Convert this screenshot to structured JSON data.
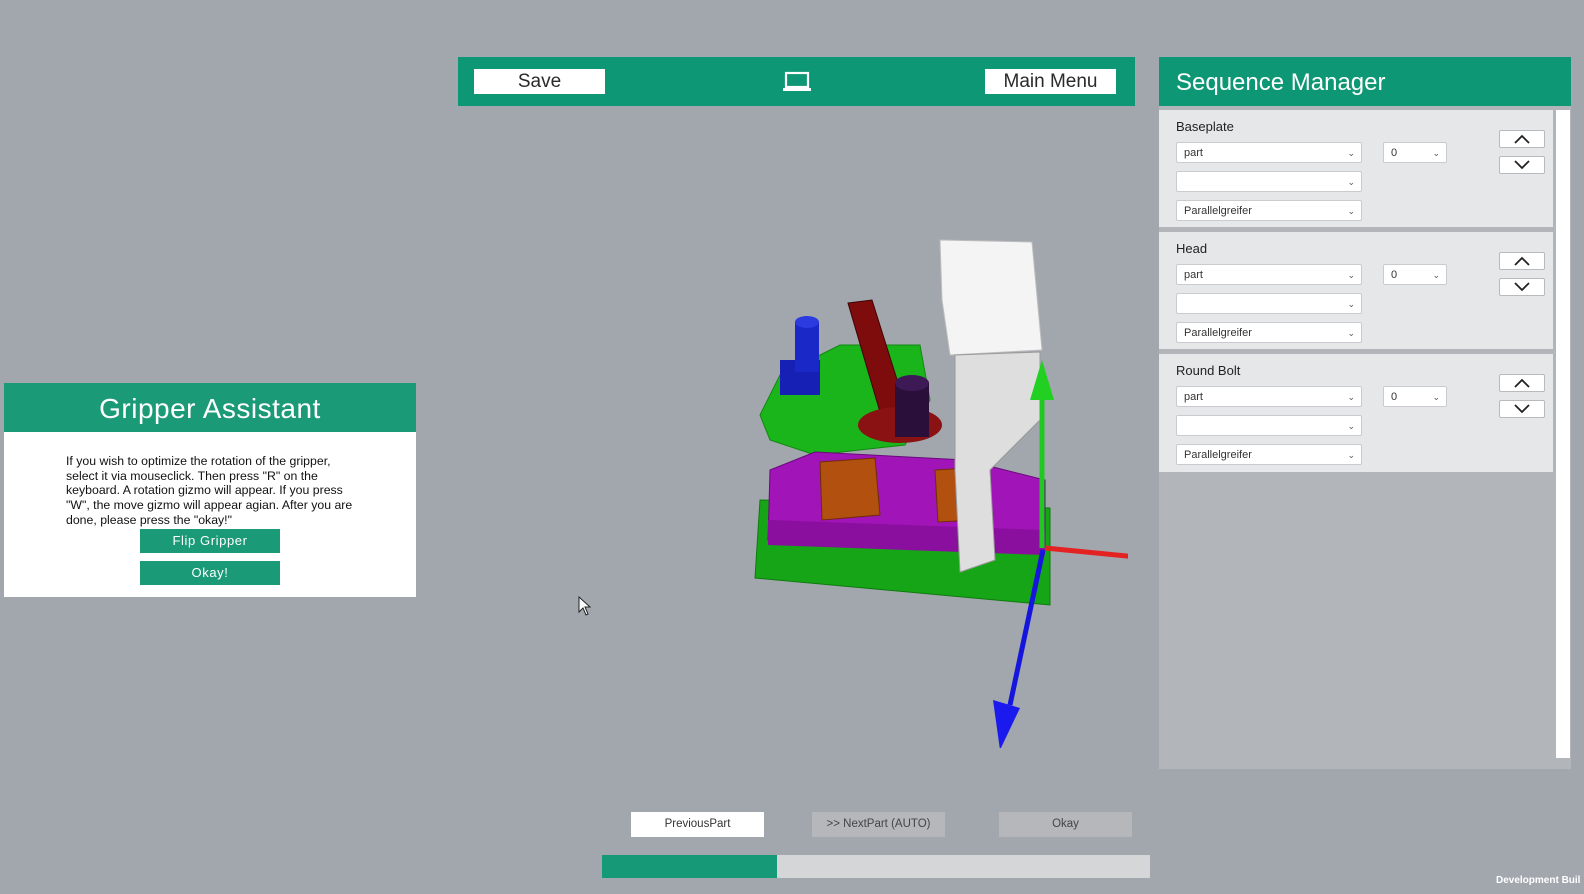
{
  "toolbar": {
    "save_label": "Save",
    "main_menu_label": "Main Menu",
    "center_icon": "laptop-icon"
  },
  "gripper_assistant": {
    "title": "Gripper Assistant",
    "instructions": "If you wish to optimize the rotation of the gripper, select it via mouseclick. Then press \"R\" on the keyboard. A rotation gizmo will appear. If you press \"W\", the move gizmo will appear agian. After you are done, please press the \"okay!\"",
    "flip_label": "Flip Gripper",
    "okay_label": "Okay!"
  },
  "sequence_manager": {
    "title": "Sequence Manager",
    "entries": [
      {
        "name": "Baseplate",
        "type": "part",
        "slot": "",
        "gripper": "Parallelgreifer",
        "index": "0"
      },
      {
        "name": "Head",
        "type": "part",
        "slot": "",
        "gripper": "Parallelgreifer",
        "index": "0"
      },
      {
        "name": "Round Bolt",
        "type": "part",
        "slot": "",
        "gripper": "Parallelgreifer",
        "index": "0"
      }
    ]
  },
  "bottom": {
    "previous_label": "PreviousPart",
    "next_label": ">> NextPart (AUTO)",
    "okay_label": "Okay"
  },
  "progress": {
    "fraction": 0.32
  },
  "footer": {
    "build_label": "Development Buil"
  },
  "colors": {
    "accent": "#0e9774",
    "accent_light": "#1a9a77"
  }
}
